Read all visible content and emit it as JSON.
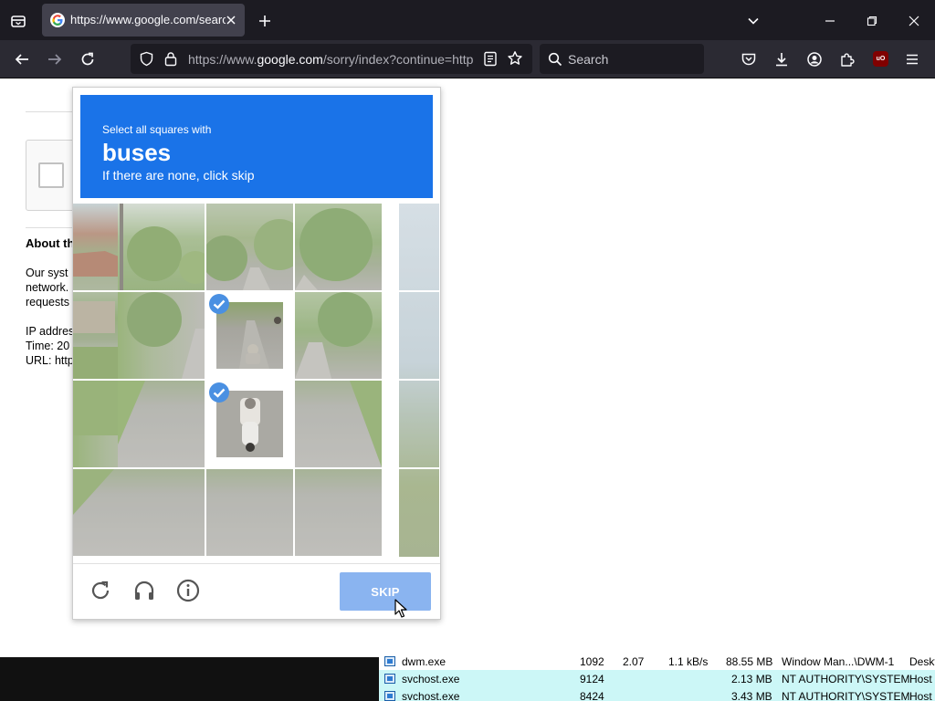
{
  "browser": {
    "tab": {
      "title": "https://www.google.com/search?q=",
      "favicon": "google-g-icon"
    },
    "urlbar": {
      "domain_prefix": "https://www.",
      "domain": "google.com",
      "path": "/sorry/index?continue=https://www.google.com/search"
    },
    "search_placeholder": "Search",
    "ublock_label": "uO",
    "accent": "#1a73e8"
  },
  "page": {
    "about_title": "About th",
    "lines": [
      "Our syst",
      "network.",
      "requests",
      "IP addres",
      "Time: 20",
      "URL: http"
    ]
  },
  "captcha": {
    "instruction": "Select all squares with",
    "target": "buses",
    "hint": "If there are none, click skip",
    "selected_tiles": [
      6,
      10
    ],
    "skip_label": "SKIP",
    "footer_icons": [
      "reload-icon",
      "audio-icon",
      "info-icon"
    ]
  },
  "task_manager": {
    "rows": [
      {
        "name": "dwm.exe",
        "pid": "1092",
        "cpu": "2.07",
        "net": "1.1 kB/s",
        "mem": "88.55 MB",
        "user": "Window Man...\\DWM-1",
        "desc": "Deskt"
      },
      {
        "name": "svchost.exe",
        "pid": "9124",
        "cpu": "",
        "net": "",
        "mem": "2.13 MB",
        "user": "NT AUTHORITY\\SYSTEM",
        "desc": "Host"
      },
      {
        "name": "svchost.exe",
        "pid": "8424",
        "cpu": "",
        "net": "",
        "mem": "3.43 MB",
        "user": "NT AUTHORITY\\SYSTEM",
        "desc": "Host"
      }
    ]
  }
}
